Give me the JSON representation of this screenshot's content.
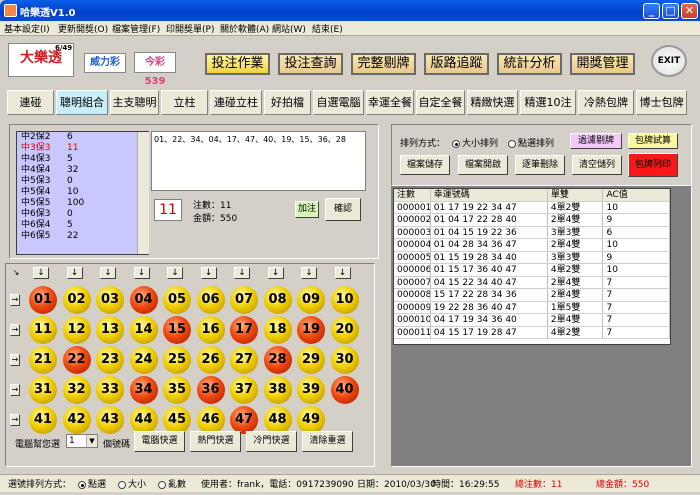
{
  "window": {
    "title": "哈樂透V1.0",
    "min": "_",
    "max": "□",
    "close": "✕"
  },
  "menu": [
    "基本設定(I)",
    "更新開獎(O)",
    "檔案管理(F)",
    "印開獎單(P)",
    "關於軟體(A)",
    "網站(W)",
    "結束(E)"
  ],
  "logos": {
    "lotto": "大樂透",
    "lotto_649": "6/49",
    "power": "威力彩",
    "daily": "今彩539"
  },
  "top_buttons": [
    "投注作業",
    "投注查詢",
    "完整剔牌",
    "版路追蹤",
    "統計分析",
    "開獎管理"
  ],
  "exit_label": "EXIT",
  "tabs": [
    "連碰",
    "聰明組合",
    "主支聰明",
    "立柱",
    "連碰立柱",
    "好拍檔",
    "自選電腦",
    "幸運全餐",
    "自定全餐",
    "精緻快選",
    "精選10注",
    "冷熱包牌",
    "博士包牌"
  ],
  "selected_tab": "聰明組合",
  "ticket_list": [
    {
      "name": "中2保2",
      "val": "6",
      "hl": false
    },
    {
      "name": "中3保3",
      "val": "11",
      "hl": true
    },
    {
      "name": "中4保3",
      "val": "5",
      "hl": false
    },
    {
      "name": "中4保4",
      "val": "32",
      "hl": false
    },
    {
      "name": "中5保3",
      "val": "0",
      "hl": false
    },
    {
      "name": "中5保4",
      "val": "10",
      "hl": false
    },
    {
      "name": "中5保5",
      "val": "100",
      "hl": false
    },
    {
      "name": "中6保3",
      "val": "0",
      "hl": false
    },
    {
      "name": "中6保4",
      "val": "5",
      "hl": false
    },
    {
      "name": "中6保5",
      "val": "22",
      "hl": false
    }
  ],
  "numbers_display": "01、22、34、04、17、47、40、19、15、36、28",
  "count_display": "11",
  "bet_label": "注數：11",
  "amount_label": "金額：550",
  "add_bet": "加注",
  "confirm": "確認",
  "balls": [
    {
      "n": "01",
      "r": true
    },
    {
      "n": "02",
      "r": false
    },
    {
      "n": "03",
      "r": false
    },
    {
      "n": "04",
      "r": true
    },
    {
      "n": "05",
      "r": false
    },
    {
      "n": "06",
      "r": false
    },
    {
      "n": "07",
      "r": false
    },
    {
      "n": "08",
      "r": false
    },
    {
      "n": "09",
      "r": false
    },
    {
      "n": "10",
      "r": false
    },
    {
      "n": "11",
      "r": false
    },
    {
      "n": "12",
      "r": false
    },
    {
      "n": "13",
      "r": false
    },
    {
      "n": "14",
      "r": false
    },
    {
      "n": "15",
      "r": true
    },
    {
      "n": "16",
      "r": false
    },
    {
      "n": "17",
      "r": true
    },
    {
      "n": "18",
      "r": false
    },
    {
      "n": "19",
      "r": true
    },
    {
      "n": "20",
      "r": false
    },
    {
      "n": "21",
      "r": false
    },
    {
      "n": "22",
      "r": true
    },
    {
      "n": "23",
      "r": false
    },
    {
      "n": "24",
      "r": false
    },
    {
      "n": "25",
      "r": false
    },
    {
      "n": "26",
      "r": false
    },
    {
      "n": "27",
      "r": false
    },
    {
      "n": "28",
      "r": true
    },
    {
      "n": "29",
      "r": false
    },
    {
      "n": "30",
      "r": false
    },
    {
      "n": "31",
      "r": false
    },
    {
      "n": "32",
      "r": false
    },
    {
      "n": "33",
      "r": false
    },
    {
      "n": "34",
      "r": true
    },
    {
      "n": "35",
      "r": false
    },
    {
      "n": "36",
      "r": true
    },
    {
      "n": "37",
      "r": false
    },
    {
      "n": "38",
      "r": false
    },
    {
      "n": "39",
      "r": false
    },
    {
      "n": "40",
      "r": true
    },
    {
      "n": "41",
      "r": false
    },
    {
      "n": "42",
      "r": false
    },
    {
      "n": "43",
      "r": false
    },
    {
      "n": "44",
      "r": false
    },
    {
      "n": "45",
      "r": false
    },
    {
      "n": "46",
      "r": false
    },
    {
      "n": "47",
      "r": true
    },
    {
      "n": "48",
      "r": false
    },
    {
      "n": "49",
      "r": false
    }
  ],
  "corner_arrow": "↘",
  "down_arrow": "↓",
  "right_arrow": "→",
  "computer_pick_label": "電腦幫您選",
  "pick_count": "1",
  "pick_unit": "個號碼",
  "pick_buttons": [
    "電腦快選",
    "熱門快選",
    "冷門快選",
    "清除重選"
  ],
  "sort_label": "排列方式：",
  "sort_opts": [
    "大小排列",
    "點選排列"
  ],
  "right_buttons": [
    "過濾剔牌",
    "包牌試算",
    "檔案儲存",
    "檔案開啟",
    "逐筆刪除",
    "清空儲列",
    "包牌列印"
  ],
  "colors": {
    "filter_btn": "#f4c8f8",
    "test_btn": "#f8f8a0",
    "print_btn": "#f81818"
  },
  "table_header": [
    "注數",
    "幸運號碼",
    "單雙",
    "AC值"
  ],
  "table_rows": [
    [
      "000001",
      "01 17 19 22 34 47",
      "4單2雙",
      "10"
    ],
    [
      "000002",
      "01 04 17 22 28 40",
      "2單4雙",
      "9"
    ],
    [
      "000003",
      "01 04 15 19 22 36",
      "3單3雙",
      "6"
    ],
    [
      "000004",
      "01 04 28 34 36 47",
      "2單4雙",
      "10"
    ],
    [
      "000005",
      "01 15 19 28 34 40",
      "3單3雙",
      "9"
    ],
    [
      "000006",
      "01 15 17 36 40 47",
      "4單2雙",
      "10"
    ],
    [
      "000007",
      "04 15 22 34 40 47",
      "2單4雙",
      "7"
    ],
    [
      "000008",
      "15 17 22 28 34 36",
      "2單4雙",
      "7"
    ],
    [
      "000009",
      "19 22 28 36 40 47",
      "1單5雙",
      "7"
    ],
    [
      "000010",
      "04 17 19 34 36 40",
      "2單4雙",
      "7"
    ],
    [
      "000011",
      "04 15 17 19 28 47",
      "4單2雙",
      "7"
    ]
  ],
  "status": {
    "select_sort": "選號排列方式：",
    "opts": [
      "點選",
      "大小",
      "亂數"
    ],
    "user": "使用者：frank，電話：0917239090",
    "date": "日期：2010/03/30",
    "time": "時間：16:29:55",
    "total_bets": "總注數：11",
    "total_amount": "總金額：550"
  }
}
